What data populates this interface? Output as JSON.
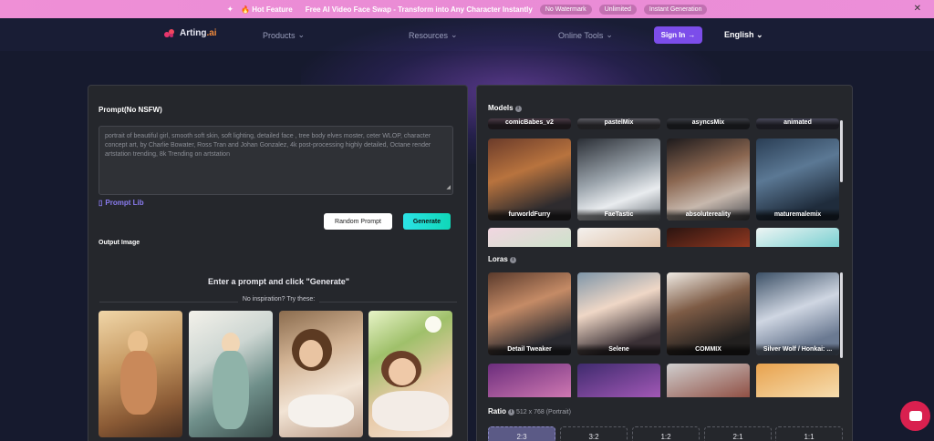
{
  "banner": {
    "spark_icon": "sparkle-icon",
    "hot_label": "🔥 Hot Feature",
    "message": "Free AI Video Face Swap - Transform into Any Character Instantly",
    "pills": [
      "No Watermark",
      "Unlimited",
      "Instant Generation"
    ],
    "close_icon": "close-icon"
  },
  "header": {
    "logo_text": "Arting",
    "logo_suffix": ".ai",
    "nav": [
      {
        "label": "Products",
        "icon": "chevron-down-icon"
      },
      {
        "label": "Resources",
        "icon": "chevron-down-icon"
      },
      {
        "label": "Online Tools",
        "icon": "chevron-down-icon"
      }
    ],
    "sign_in": "Sign In",
    "sign_in_icon": "arrow-right-icon",
    "language": "English",
    "brand_color": "#7c4dea"
  },
  "left": {
    "prompt_label": "Prompt(No NSFW)",
    "prompt_text": "portrait of beautiful girl, smooth soft skin, soft lighting, detailed face , tree body elves moster, ceter WLOP, character concept art, by Charlie Bowater, Ross Tran and Johan Gonzalez, 4k post-processing highly detailed, Octane render artstation trending, 8k Trending on artstation",
    "prompt_lib": "Prompt Lib",
    "random_prompt": "Random Prompt",
    "generate": "Generate",
    "output_label": "Output Image",
    "empty_title": "Enter a prompt and click \"Generate\"",
    "no_inspiration": "No inspiration? Try these:"
  },
  "right": {
    "models_label": "Models",
    "models_top": [
      "comicBabes_v2",
      "pastelMix",
      "asyncsMix",
      "animated"
    ],
    "models": [
      "furworldFurry",
      "FaeTastic",
      "absoluterеality",
      "maturemalemix"
    ],
    "loras_label": "Loras",
    "loras": [
      "Detail Tweaker",
      "Selene",
      "COMMIX",
      "Silver Wolf / Honkai: ..."
    ],
    "ratio_label": "Ratio",
    "ratio_value": "512 x 768 (Portrait)",
    "ratios": [
      "2:3",
      "3:2",
      "1:2",
      "2:1",
      "1:1"
    ]
  },
  "chat_icon": "chat-icon"
}
